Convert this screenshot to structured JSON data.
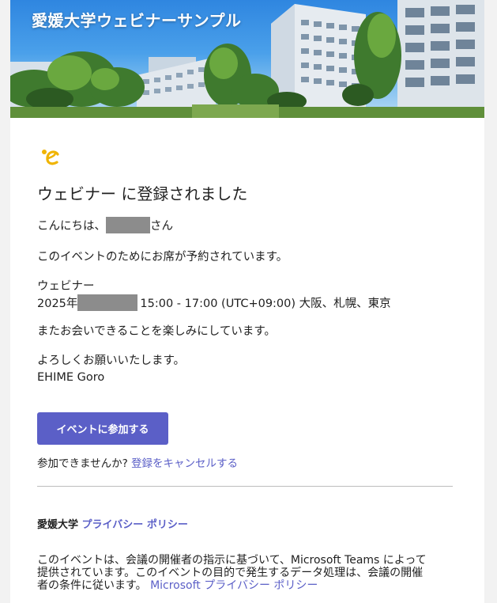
{
  "banner": {
    "title": "愛媛大学ウェビナーサンプル"
  },
  "heading": "ウェビナー に登録されました",
  "greeting": {
    "prefix": "こんにちは、",
    "suffix": "さん"
  },
  "reservation_text": "このイベントのためにお席が予約されています。",
  "event": {
    "type": "ウェビナー",
    "year": "2025年",
    "time": "15:00 - 17:00 (UTC+09:00) 大阪、札幌、東京"
  },
  "see_you_text": "またお会いできることを楽しみにしています。",
  "closing": "よろしくお願いいたします。",
  "signature": "EHIME Goro",
  "join_button": "イベントに参加する",
  "cancel": {
    "question": "参加できませんか?",
    "link": "登録をキャンセルする"
  },
  "footer": {
    "org": "愛媛大学",
    "privacy_link": "プライバシー ポリシー",
    "disclaimer": "このイベントは、会議の開催者の指示に基づいて、Microsoft Teams によって提供されています。このイベントの目的で発生するデータ処理は、会議の開催者の条件に従います。",
    "ms_privacy_link": "Microsoft プライバシー ポリシー"
  },
  "colors": {
    "accent": "#5b5fc7",
    "logo": "#f0b400",
    "redaction": "#8c8c8c"
  }
}
